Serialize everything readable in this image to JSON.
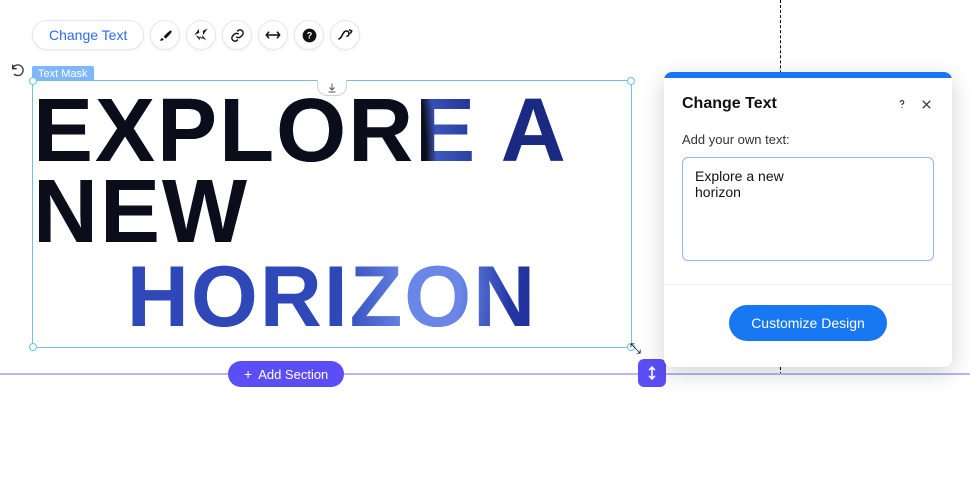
{
  "toolbar": {
    "change_text_label": "Change Text",
    "icons": {
      "brush": "brush-icon",
      "animation": "animation-icon",
      "link": "link-icon",
      "stretch": "stretch-icon",
      "help": "help-icon",
      "path": "path-icon"
    }
  },
  "canvas": {
    "element_label": "Text Mask",
    "text_line_1": "EXPLORE A NEW",
    "text_line_2": "HORIZON"
  },
  "section": {
    "add_button_label": "Add Section"
  },
  "panel": {
    "title": "Change Text",
    "field_label": "Add your own text:",
    "text_value": "Explore a new\nhorizon",
    "primary_button": "Customize Design"
  }
}
